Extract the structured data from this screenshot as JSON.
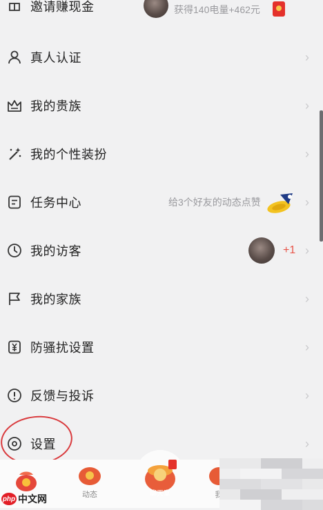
{
  "menu": {
    "invite": {
      "label": "邀请赚现金",
      "reward": "获得140电量+462元"
    },
    "realname": {
      "label": "真人认证"
    },
    "noble": {
      "label": "我的贵族"
    },
    "style": {
      "label": "我的个性装扮"
    },
    "tasks": {
      "label": "任务中心",
      "hint": "给3个好友的动态点赞"
    },
    "visitors": {
      "label": "我的访客",
      "count": "+1"
    },
    "family": {
      "label": "我的家族"
    },
    "antispam": {
      "label": "防骚扰设置"
    },
    "feedback": {
      "label": "反馈与投诉"
    },
    "settings": {
      "label": "设置"
    }
  },
  "chevron": "›",
  "tabbar": {
    "tab2": "动态",
    "tab3": "聊天室",
    "tab4": "我"
  },
  "watermark": {
    "logo": "php",
    "text": "中文网"
  },
  "colors": {
    "accent": "#e4312b",
    "annotation": "#d9393c"
  }
}
